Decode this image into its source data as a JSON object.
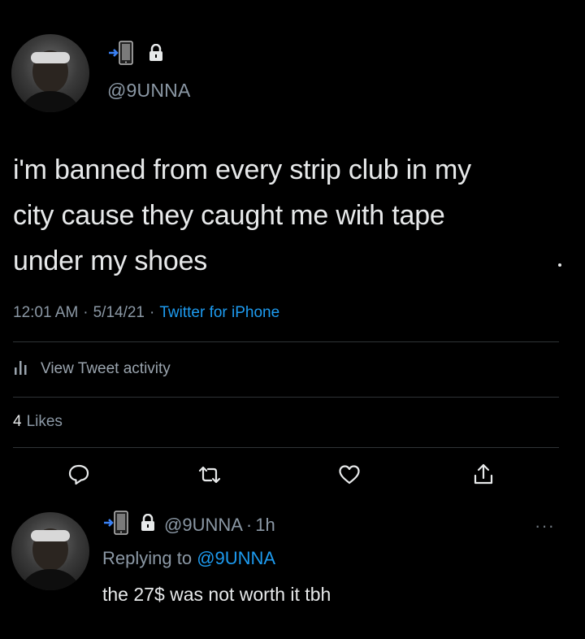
{
  "tweet": {
    "handle": "@9UNNA",
    "text_lines": [
      "i'm banned from every strip club in my",
      "city cause they caught me with tape",
      "under my shoes"
    ],
    "time": "12:01 AM",
    "date": "5/14/21",
    "source": "Twitter for iPhone",
    "separator": "·",
    "activity_label": "View Tweet activity",
    "likes_count": "4",
    "likes_label": "Likes"
  },
  "icons": {
    "device": "phone-transfer-icon",
    "lock": "lock-icon",
    "activity": "bar-chart-icon",
    "reply": "reply-icon",
    "retweet": "retweet-icon",
    "like": "heart-icon",
    "share": "share-icon",
    "more": "more-icon"
  },
  "reply": {
    "handle": "@9UNNA",
    "separator": "·",
    "age": "1h",
    "replying_prefix": "Replying to",
    "replying_to": "@9UNNA",
    "text": "the 27$ was not worth it tbh",
    "more": "···"
  },
  "colors": {
    "background": "#000000",
    "text": "#e7e9ea",
    "secondary": "#8b98a5",
    "accent": "#1d9bf0",
    "divider": "#2f3336"
  }
}
